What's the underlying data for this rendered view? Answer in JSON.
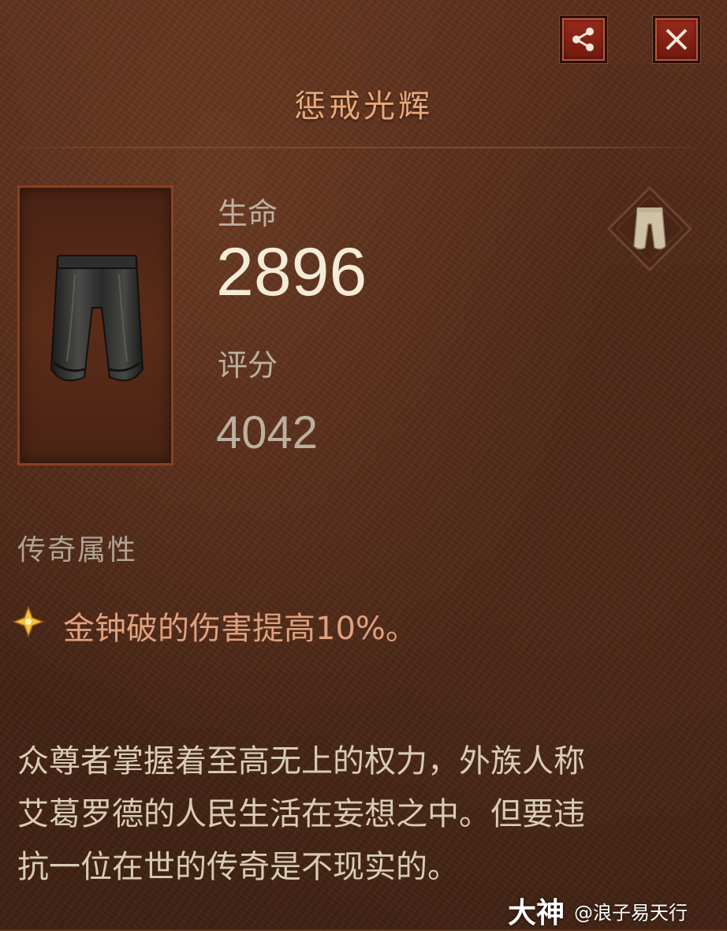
{
  "header": {
    "title": "惩戒光辉",
    "share_icon": "share-icon",
    "close_icon": "close-icon"
  },
  "item": {
    "image_icon": "pants-icon",
    "slot_icon": "pants-slot-icon"
  },
  "stats": {
    "life_label": "生命",
    "life_value": "2896",
    "score_label": "评分",
    "score_value": "4042"
  },
  "legendary": {
    "section_title": "传奇属性",
    "bullet_icon": "legendary-star-icon",
    "affix": "金钟破的伤害提高10%。"
  },
  "flavor_text": {
    "line1": "众尊者掌握着至高无上的权力，外族人称",
    "line2": "艾葛罗德的人民生活在妄想之中。但要违",
    "line3": "抗一位在世的传奇是不现实的。"
  },
  "watermark": {
    "logo": "大神",
    "user": "@浪子易天行"
  },
  "colors": {
    "title": "#e8a878",
    "affix": "#e0a07c",
    "button_red": "#9a2a1c",
    "frame_border": "#8a4020"
  }
}
